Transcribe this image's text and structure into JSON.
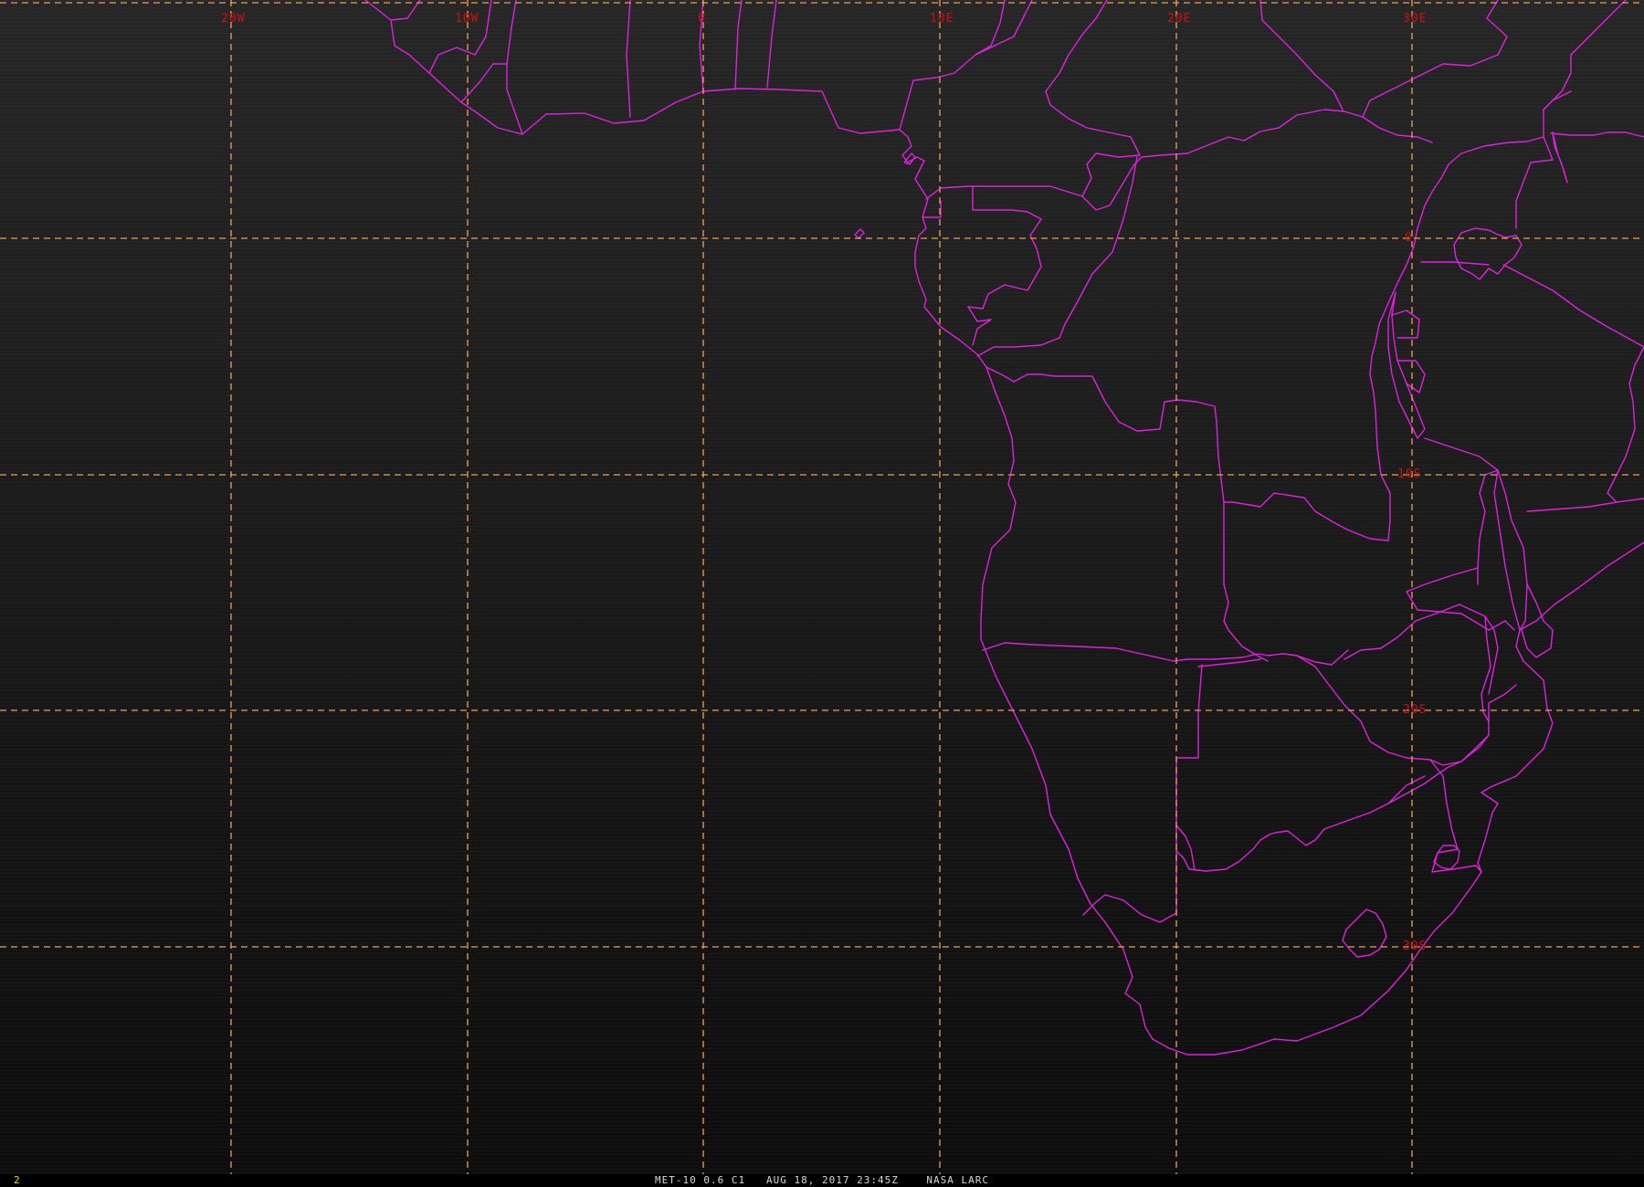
{
  "imagery": {
    "background_top": "#262626",
    "background_bottom": "#0d0d0d",
    "grid_color": "#f0a050",
    "label_color": "#cc1111",
    "border_color": "#e020e0"
  },
  "grid": {
    "longitude_labels": [
      "20W",
      "10W",
      "0",
      "10E",
      "20E",
      "30E"
    ],
    "latitude_labels": [
      "0",
      "10S",
      "20S",
      "30S"
    ]
  },
  "status_bar": {
    "frame_number": "2",
    "product": "MET-10 0.6 C1",
    "timestamp": "AUG 18, 2017 23:45Z",
    "source": "NASA LARC",
    "frame_color": "#e8e000",
    "text_color": "#d8d8d8"
  }
}
